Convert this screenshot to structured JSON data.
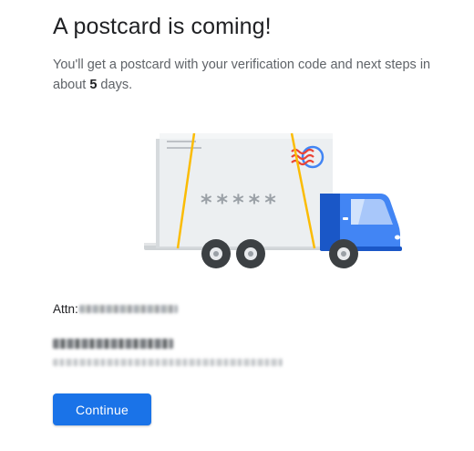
{
  "header": {
    "title": "A postcard is coming!",
    "description_prefix": "You'll get a postcard with your verification code and next steps in about ",
    "days": "5",
    "description_suffix": " days."
  },
  "illustration": {
    "postcard_code": "*****",
    "icon": "postcard-truck-illustration",
    "colors": {
      "truck_blue": "#4285f4",
      "truck_dark_blue": "#1a57c7",
      "postcard_bg": "#eceff1",
      "strap_yellow": "#fbbc04",
      "stamp_red": "#ea4335"
    }
  },
  "address": {
    "attn_label": "Attn:"
  },
  "actions": {
    "continue_label": "Continue"
  },
  "colors": {
    "primary": "#1a73e8",
    "text_primary": "#202124",
    "text_secondary": "#5f6368"
  }
}
